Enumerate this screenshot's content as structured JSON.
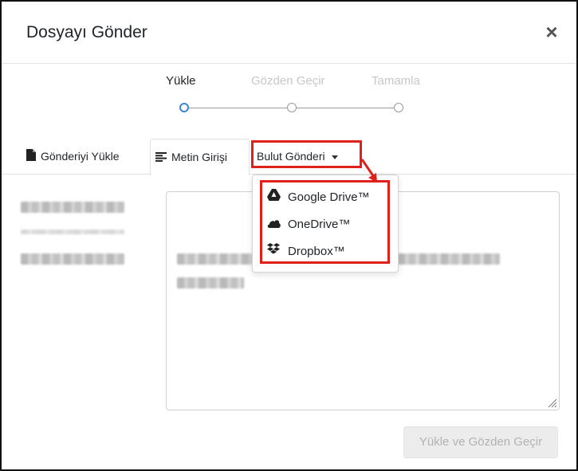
{
  "modal": {
    "title": "Dosyayı Gönder",
    "close_label": "×"
  },
  "stepper": {
    "steps": [
      {
        "label": "Yükle",
        "state": "active"
      },
      {
        "label": "Gözden Geçir",
        "state": "inactive"
      },
      {
        "label": "Tamamla",
        "state": "inactive"
      }
    ],
    "active_color": "#3b84d6"
  },
  "tabs": [
    {
      "label": "Gönderiyi Yükle",
      "icon": "file-icon"
    },
    {
      "label": "Metin Girişi",
      "icon": "align-left-icon",
      "active": true
    },
    {
      "label": "Bulut Gönderi",
      "icon": "caret-down-icon"
    }
  ],
  "dropdown": {
    "items": [
      {
        "label": "Google Drive™",
        "icon": "google-drive-icon"
      },
      {
        "label": "OneDrive™",
        "icon": "onedrive-icon"
      },
      {
        "label": "Dropbox™",
        "icon": "dropbox-icon"
      }
    ]
  },
  "submit_button": "Yükle ve Gözden Geçir",
  "highlight_color": "#e0201a"
}
